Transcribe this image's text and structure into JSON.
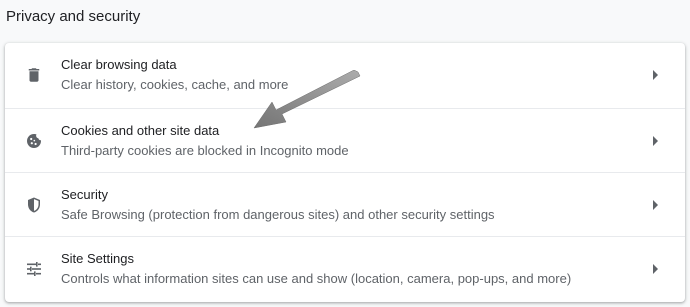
{
  "section": {
    "title": "Privacy and security"
  },
  "items": [
    {
      "label": "Clear browsing data",
      "sublabel": "Clear history, cookies, cache, and more",
      "icon": "trash-icon"
    },
    {
      "label": "Cookies and other site data",
      "sublabel": "Third-party cookies are blocked in Incognito mode",
      "icon": "cookie-icon"
    },
    {
      "label": "Security",
      "sublabel": "Safe Browsing (protection from dangerous sites) and other security settings",
      "icon": "shield-icon"
    },
    {
      "label": "Site Settings",
      "sublabel": "Controls what information sites can use and show (location, camera, pop-ups, and more)",
      "icon": "tune-sliders-icon"
    }
  ],
  "colors": {
    "background": "#f8f9fa",
    "card": "#ffffff",
    "primary_text": "#202124",
    "secondary_text": "#5f6368",
    "icon": "#5f6368",
    "annotation_arrow": "#7a7a7a"
  }
}
